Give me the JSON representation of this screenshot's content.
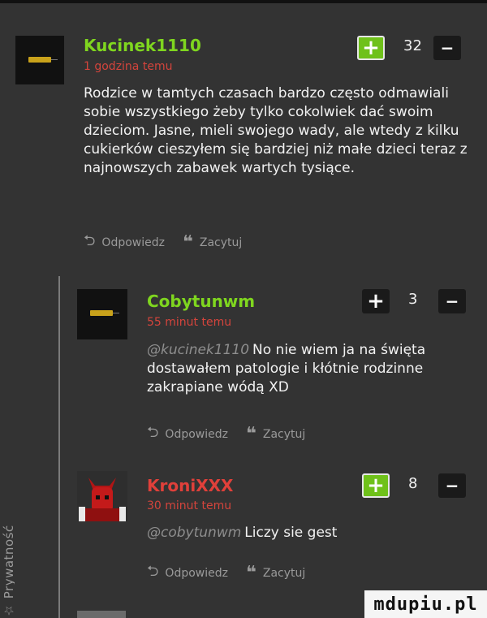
{
  "side_label": "☆ Prywatność",
  "comments": [
    {
      "username": "Kucinek1110",
      "time": "1 godzina temu",
      "text": "Rodzice w tamtych czasach bardzo często odmawiali sobie wszystkiego żeby tylko cokolwiek dać swoim dzieciom. Jasne, mieli swojego wady, ale wtedy z kilku cukierków cieszyłem się bardziej niż małe dzieci teraz z najnowszych zabawek wartych tysiące.",
      "mention": "",
      "votes": "32",
      "plus_label": "+",
      "minus_label": "−",
      "plus_active": true,
      "reply_label": "Odpowiedz",
      "quote_label": "Zacytuj"
    },
    {
      "username": "Cobytunwm",
      "time": "55 minut temu",
      "mention": "@kucinek1110",
      "text": "No nie wiem ja na święta dostawałem patologie i kłótnie rodzinne zakrapiane wódą XD",
      "votes": "3",
      "plus_label": "+",
      "minus_label": "−",
      "plus_active": false,
      "reply_label": "Odpowiedz",
      "quote_label": "Zacytuj"
    },
    {
      "username": "KroniXXX",
      "time": "30 minut temu",
      "mention": "@cobytunwm",
      "text": "Liczy sie gest",
      "votes": "8",
      "plus_label": "+",
      "minus_label": "−",
      "plus_active": true,
      "reply_label": "Odpowiedz",
      "quote_label": "Zacytuj"
    }
  ],
  "watermark": "mdupiu.pl",
  "colors": {
    "background": "#333333",
    "username": "#7fd61f",
    "time": "#d4443c",
    "plus_active": "#6fc11a"
  }
}
